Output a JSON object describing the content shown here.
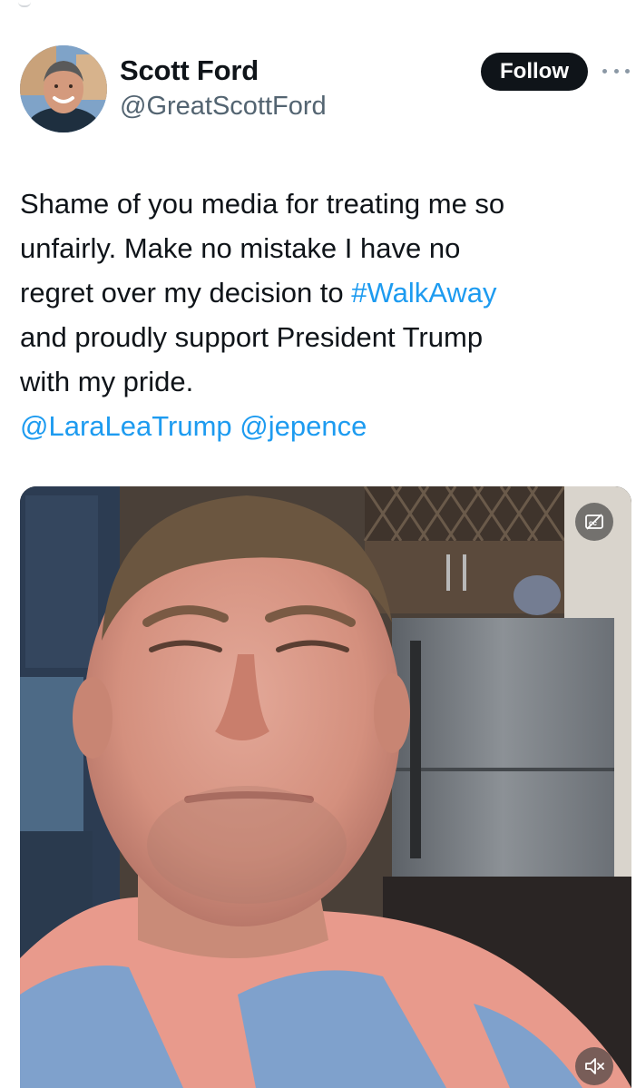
{
  "tweet": {
    "author": {
      "display_name": "Scott Ford",
      "handle": "@GreatScottFord"
    },
    "follow_label": "Follow",
    "text_lines": [
      [
        "Shame of you media for treating me so"
      ],
      [
        "unfairly. Make no mistake I have no"
      ],
      [
        "regret over my decision to ",
        "#WalkAway"
      ],
      [
        "and proudly support President Trump"
      ],
      [
        "with my pride."
      ]
    ],
    "mentions": [
      "@LaraLeaTrump",
      "@jepence"
    ],
    "media": {
      "type": "video",
      "captions_icon": "closed-captions-off-icon",
      "mute_icon": "speaker-muted-icon"
    }
  },
  "colors": {
    "text": "#0f1419",
    "secondary_text": "#536471",
    "link": "#1d9bf0",
    "follow_button_bg": "#0f1419",
    "follow_button_text": "#ffffff"
  }
}
